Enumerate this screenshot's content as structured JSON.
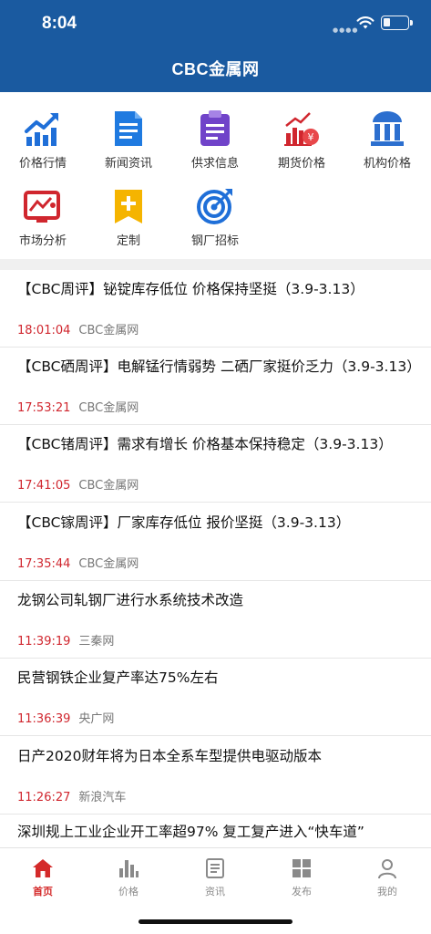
{
  "status_bar": {
    "time": "8:04"
  },
  "header": {
    "title": "CBC金属网"
  },
  "menu": [
    {
      "label": "价格行情",
      "icon": "chart-trend-icon"
    },
    {
      "label": "新闻资讯",
      "icon": "document-icon"
    },
    {
      "label": "供求信息",
      "icon": "clipboard-icon"
    },
    {
      "label": "期货价格",
      "icon": "futures-bar-yen-icon"
    },
    {
      "label": "机构价格",
      "icon": "institution-icon"
    },
    {
      "label": "市场分析",
      "icon": "market-analysis-icon"
    },
    {
      "label": "定制",
      "icon": "customize-bookmark-icon"
    },
    {
      "label": "钢厂招标",
      "icon": "target-icon"
    }
  ],
  "news": [
    {
      "title": "【CBC周评】铋锭库存低位 价格保持坚挺（3.9-3.13）",
      "time": "18:01:04",
      "source": "CBC金属网"
    },
    {
      "title": "【CBC硒周评】电解锰行情弱势 二硒厂家挺价乏力（3.9-3.13）",
      "time": "17:53:21",
      "source": "CBC金属网"
    },
    {
      "title": "【CBC锗周评】需求有增长 价格基本保持稳定（3.9-3.13）",
      "time": "17:41:05",
      "source": "CBC金属网"
    },
    {
      "title": "【CBC镓周评】厂家库存低位 报价坚挺（3.9-3.13）",
      "time": "17:35:44",
      "source": "CBC金属网"
    },
    {
      "title": "龙钢公司轧钢厂进行水系统技术改造",
      "time": "11:39:19",
      "source": "三秦网"
    },
    {
      "title": "民营钢铁企业复产率达75%左右",
      "time": "11:36:39",
      "source": "央广网"
    },
    {
      "title": "日产2020财年将为日本全系车型提供电驱动版本",
      "time": "11:26:27",
      "source": "新浪汽车"
    },
    {
      "title": "深圳规上工业企业开工率超97% 复工复产进入“快车道”",
      "time": "",
      "source": ""
    }
  ],
  "tabs": [
    {
      "label": "首页",
      "icon": "home-icon",
      "active": true
    },
    {
      "label": "价格",
      "icon": "bar-chart-icon",
      "active": false
    },
    {
      "label": "资讯",
      "icon": "news-icon",
      "active": false
    },
    {
      "label": "发布",
      "icon": "grid-icon",
      "active": false
    },
    {
      "label": "我的",
      "icon": "user-icon",
      "active": false
    }
  ],
  "colors": {
    "header_bg": "#1a5aa0",
    "accent_blue": "#1f6fd8",
    "accent_purple": "#6c3fc6",
    "accent_red": "#d0262e",
    "accent_yellow": "#f5b400",
    "tab_active": "#d42a2a",
    "tab_inactive": "#8a8a8a"
  }
}
